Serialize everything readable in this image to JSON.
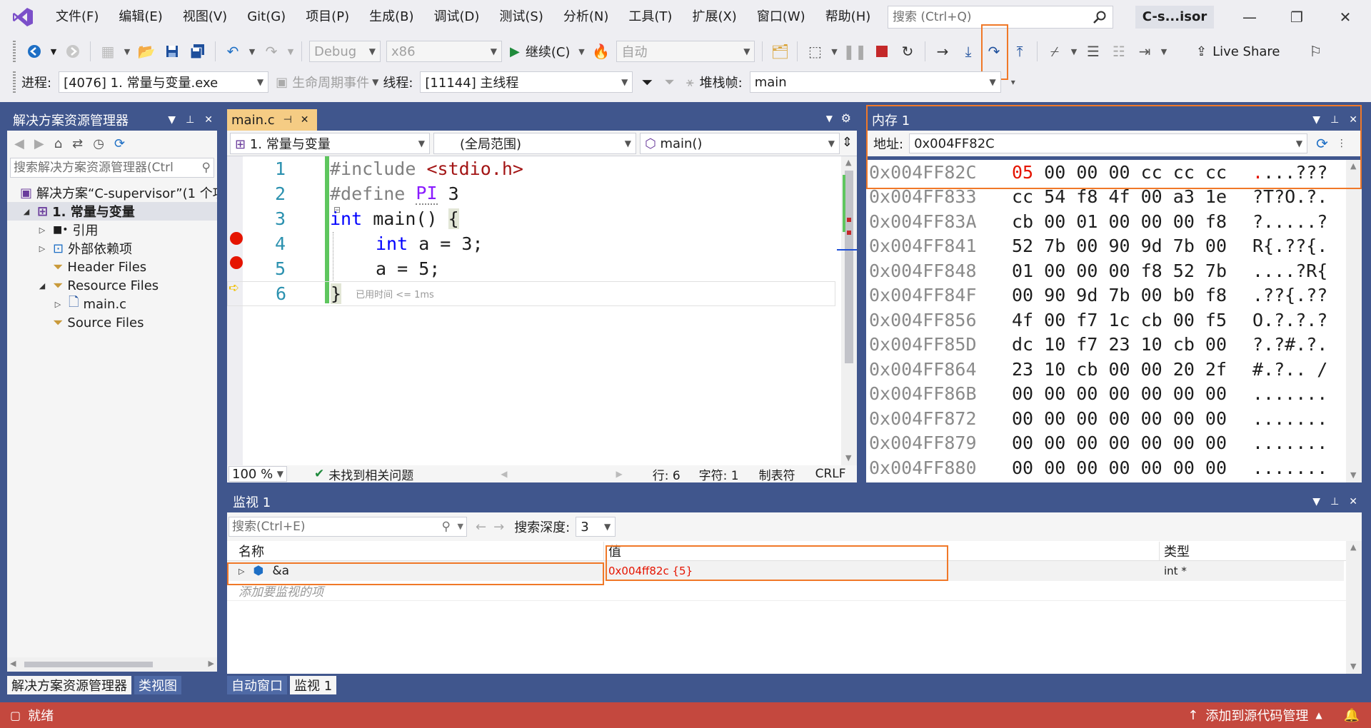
{
  "menu": [
    "文件(F)",
    "编辑(E)",
    "视图(V)",
    "Git(G)",
    "项目(P)",
    "生成(B)",
    "调试(D)",
    "测试(S)",
    "分析(N)",
    "工具(T)",
    "扩展(X)",
    "窗口(W)",
    "帮助(H)"
  ],
  "search": {
    "placeholder": "搜索 (Ctrl+Q)"
  },
  "solution_badge": "C-s...isor",
  "toolbar1": {
    "config": "Debug",
    "platform": "x86",
    "continue_label": "继续(C)",
    "auto_label": "自动",
    "live_share": "Live Share"
  },
  "toolbar2": {
    "process_label": "进程:",
    "process_value": "[4076] 1. 常量与变量.exe",
    "lifecycle_label": "生命周期事件",
    "thread_label": "线程:",
    "thread_value": "[11144] 主线程",
    "stack_label": "堆栈帧:",
    "stack_value": "main"
  },
  "solexp": {
    "title": "解决方案资源管理器",
    "search_placeholder": "搜索解决方案资源管理器(Ctrl",
    "items": [
      {
        "label": "解决方案“C-supervisor”(1 个项",
        "depth": 0
      },
      {
        "label": "1. 常量与变量",
        "depth": 1
      },
      {
        "label": "引用",
        "depth": 2
      },
      {
        "label": "外部依赖项",
        "depth": 2
      },
      {
        "label": "Header Files",
        "depth": 2
      },
      {
        "label": "Resource Files",
        "depth": 2
      },
      {
        "label": "main.c",
        "depth": 3
      },
      {
        "label": "Source Files",
        "depth": 2
      }
    ],
    "tab_active": "解决方案资源管理器",
    "tab_other": "类视图"
  },
  "editor": {
    "tab": "main.c",
    "nav_project": "1. 常量与变量",
    "nav_scope": "(全局范围)",
    "nav_func": "main()",
    "lines": [
      "1",
      "2",
      "3",
      "4",
      "5",
      "6"
    ],
    "code": {
      "l1a": "#include ",
      "l1b": "<stdio.h>",
      "l2a": "#define ",
      "l2b": "PI",
      " l2c": " 3",
      "l3a": "int",
      " l3b": " main() {",
      "l4a": "int",
      " l4b": " a = 3;",
      "l5": "a = 5;",
      "l6": "}",
      "elapsed": "已用时间 <= 1ms"
    },
    "zoom": "100 %",
    "issues": "未找到相关问题",
    "row": "行: 6",
    "col": "字符: 1",
    "tabs": "制表符",
    "eol": "CRLF"
  },
  "memory": {
    "title": "内存 1",
    "address_label": "地址:",
    "address_value": "0x004FF82C",
    "rows": [
      {
        "addr": "0x004FF82C",
        "first": "05",
        "bytes": " 00 00 00 cc cc cc",
        "ascii": "....???"
      },
      {
        "addr": "0x004FF833",
        "first": "",
        "bytes": "cc 54 f8 4f 00 a3 1e",
        "ascii": "?T?O.?."
      },
      {
        "addr": "0x004FF83A",
        "first": "",
        "bytes": "cb 00 01 00 00 00 f8",
        "ascii": "?.....?"
      },
      {
        "addr": "0x004FF841",
        "first": "",
        "bytes": "52 7b 00 90 9d 7b 00",
        "ascii": "R{.??{."
      },
      {
        "addr": "0x004FF848",
        "first": "",
        "bytes": "01 00 00 00 f8 52 7b",
        "ascii": "....?R{"
      },
      {
        "addr": "0x004FF84F",
        "first": "",
        "bytes": "00 90 9d 7b 00 b0 f8",
        "ascii": ".??{.??"
      },
      {
        "addr": "0x004FF856",
        "first": "",
        "bytes": "4f 00 f7 1c cb 00 f5",
        "ascii": "O.?.?.?"
      },
      {
        "addr": "0x004FF85D",
        "first": "",
        "bytes": "dc 10 f7 23 10 cb 00",
        "ascii": "?.?#.?."
      },
      {
        "addr": "0x004FF864",
        "first": "",
        "bytes": "23 10 cb 00 00 20 2f",
        "ascii": "#.?.. /"
      },
      {
        "addr": "0x004FF86B",
        "first": "",
        "bytes": "00 00 00 00 00 00 00",
        "ascii": "......."
      },
      {
        "addr": "0x004FF872",
        "first": "",
        "bytes": "00 00 00 00 00 00 00",
        "ascii": "......."
      },
      {
        "addr": "0x004FF879",
        "first": "",
        "bytes": "00 00 00 00 00 00 00",
        "ascii": "......."
      },
      {
        "addr": "0x004FF880",
        "first": "",
        "bytes": "00 00 00 00 00 00 00",
        "ascii": "......."
      }
    ]
  },
  "watch": {
    "title": "监视 1",
    "search_placeholder": "搜索(Ctrl+E)",
    "depth_label": "搜索深度:",
    "depth_value": "3",
    "col_name": "名称",
    "col_value": "值",
    "col_type": "类型",
    "row_name": "&a",
    "row_value": "0x004ff82c {5}",
    "row_type": "int *",
    "add_hint": "添加要监视的项",
    "tab_auto": "自动窗口",
    "tab_watch": "监视 1"
  },
  "status": {
    "ready": "就绪",
    "source_control": "添加到源代码管理"
  },
  "colors": {
    "accent": "#40568d",
    "highlight": "#f07828",
    "status": "#c4483e"
  }
}
